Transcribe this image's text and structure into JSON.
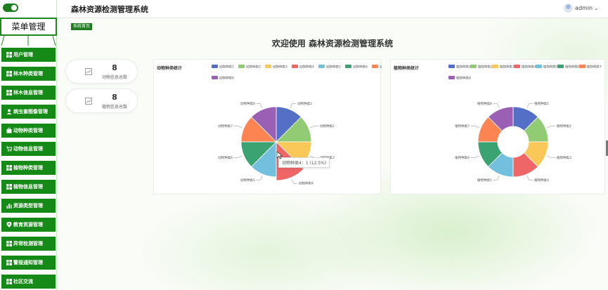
{
  "app": {
    "title": "森林资源检测管理系统",
    "user": "admin"
  },
  "sidebar": {
    "header": "菜单管理",
    "items": [
      {
        "label": "用户管理",
        "icon": "grid-icon"
      },
      {
        "label": "林木种类管理",
        "icon": "grid-icon"
      },
      {
        "label": "林木信息管理",
        "icon": "grid-icon"
      },
      {
        "label": "病虫害图像管理",
        "icon": "user-icon"
      },
      {
        "label": "动物种类管理",
        "icon": "briefcase-icon"
      },
      {
        "label": "动物信息管理",
        "icon": "cart-icon"
      },
      {
        "label": "植物种类管理",
        "icon": "grid-icon"
      },
      {
        "label": "植物信息管理",
        "icon": "grid-icon"
      },
      {
        "label": "资源类型管理",
        "icon": "bar-chart-icon"
      },
      {
        "label": "教育资源管理",
        "icon": "pin-icon"
      },
      {
        "label": "异常检测管理",
        "icon": "grid-icon"
      },
      {
        "label": "警报通知管理",
        "icon": "grid-icon"
      },
      {
        "label": "社区交流",
        "icon": "grid-icon"
      }
    ]
  },
  "breadcrumb": "系统首页",
  "welcome": "欢迎使用 森林资源检测管理系统",
  "stats": [
    {
      "value": "8",
      "label": "动物信息总数"
    },
    {
      "value": "8",
      "label": "植物信息总数"
    }
  ],
  "tooltip": "动物种类4：1 (12.5%)",
  "colors": [
    "#5470c6",
    "#91cc75",
    "#fac858",
    "#ee6666",
    "#73c0de",
    "#3ba272",
    "#fc8452",
    "#9a60b4"
  ],
  "chart_data": [
    {
      "type": "pie",
      "title": "动物种类统计",
      "categories": [
        "动物种类1",
        "动物种类2",
        "动物种类3",
        "动物种类4",
        "动物种类5",
        "动物种类6",
        "动物种类7",
        "动物种类8"
      ],
      "values": [
        1,
        1,
        1,
        1,
        1,
        1,
        1,
        1
      ],
      "highlighted": "动物种类4",
      "legend": "top"
    },
    {
      "type": "pie",
      "variant": "donut",
      "title": "植物种类统计",
      "categories": [
        "植物种类1",
        "植物种类2",
        "植物种类3",
        "植物种类4",
        "植物种类5",
        "植物种类6",
        "植物种类7",
        "植物种类8"
      ],
      "values": [
        1,
        1,
        1,
        1,
        1,
        1,
        1,
        1
      ],
      "legend": "top"
    }
  ]
}
